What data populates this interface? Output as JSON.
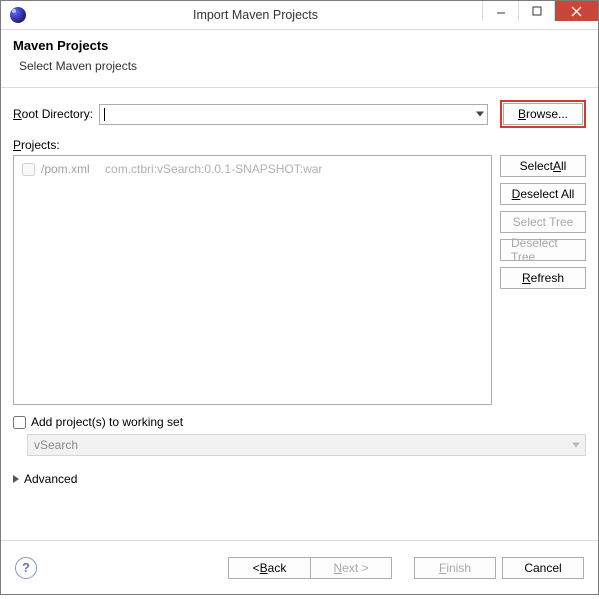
{
  "window": {
    "title": "Import Maven Projects"
  },
  "header": {
    "title": "Maven Projects",
    "subtitle": "Select Maven projects"
  },
  "rootDir": {
    "label_pre": "R",
    "label_post": "oot Directory:",
    "value": ""
  },
  "browse": {
    "pre": "B",
    "post": "rowse..."
  },
  "projects": {
    "label_pre": "P",
    "label_post": "rojects:"
  },
  "list": [
    {
      "file": "/pom.xml",
      "detail": "com.ctbri:vSearch:0.0.1-SNAPSHOT:war"
    }
  ],
  "sideButtons": {
    "selectAll": {
      "pre": "Select ",
      "u": "A",
      "post": "ll"
    },
    "deselectAll": {
      "u": "D",
      "post": "eselect All"
    },
    "selectTree": "Select Tree",
    "deselectTree": "Deselect Tree",
    "refresh": {
      "pre": "",
      "u": "R",
      "post": "efresh"
    }
  },
  "workingSet": {
    "label": "Add project(s) to working set",
    "value": "vSearch"
  },
  "advanced": {
    "label": "Advanced"
  },
  "footer": {
    "back": {
      "pre": "< ",
      "u": "B",
      "post": "ack"
    },
    "next": {
      "u": "N",
      "post": "ext >"
    },
    "finish": {
      "u": "F",
      "post": "inish"
    },
    "cancel": "Cancel"
  }
}
